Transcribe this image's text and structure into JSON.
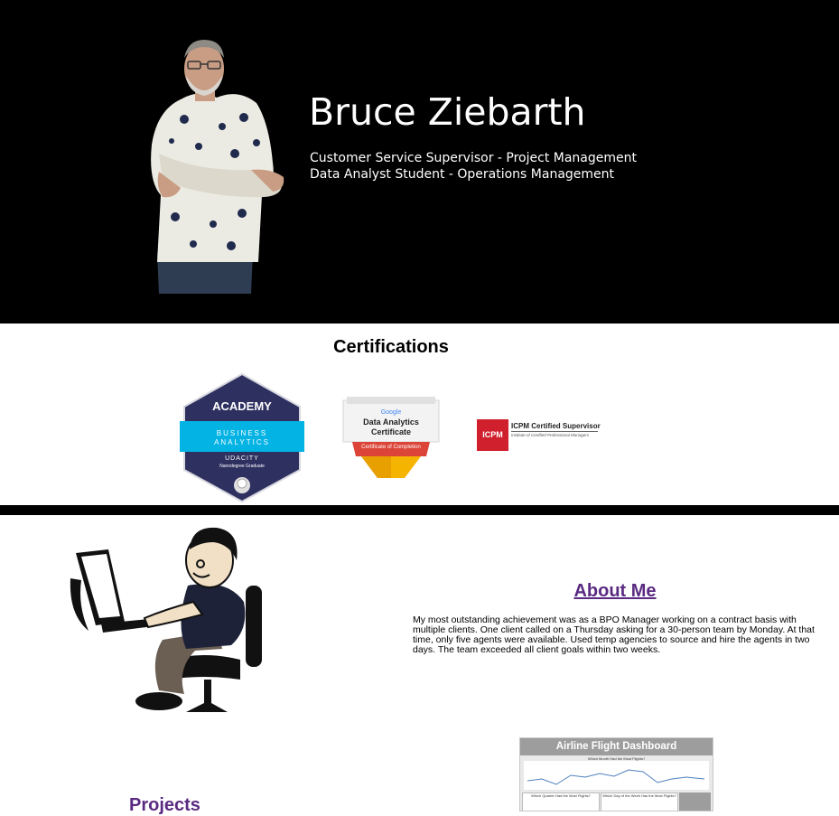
{
  "hero": {
    "name": "Bruce Ziebarth",
    "subtitle_line1": "Customer Service Supervisor - Project Management",
    "subtitle_line2": "Data Analyst Student - Operations Management"
  },
  "certifications": {
    "title": "Certifications",
    "udacity": {
      "brand": "ACADEMY",
      "band_line1": "BUSINESS",
      "band_line2": "ANALYTICS",
      "org": "UDACITY",
      "caption": "Nanodegree Graduate"
    },
    "google": {
      "brand": "Google",
      "line1": "Data Analytics",
      "line2": "Certificate",
      "ribbon": "Certificate of Completion"
    },
    "icpm": {
      "logo": "ICPM",
      "title": "ICPM Certified Supervisor",
      "subtitle": "Institute of Certified Professional Managers"
    }
  },
  "about": {
    "title": "About Me",
    "text": "My most outstanding achievement was as a BPO Manager working on a contract basis with multiple clients. One client called on a Thursday asking for a 30-person team by Monday. At that time, only five agents were available. Used temp agencies to source and hire the agents in two days. The team exceeded all client goals within two weeks."
  },
  "projects": {
    "title": "Projects",
    "dashboard": {
      "title": "Airline Flight Dashboard",
      "subtitle": "Which Month Had the Most Flights?",
      "panel1": "Which Quarter Had the Most Flights?",
      "panel2": "Which Day of the Week Has the Most Flights?"
    }
  },
  "colors": {
    "hero_bg": "#000000",
    "link_purple": "#5a2a82",
    "udacity_navy": "#2e3060",
    "udacity_band": "#02b3e4",
    "icpm_red": "#d0202e"
  }
}
